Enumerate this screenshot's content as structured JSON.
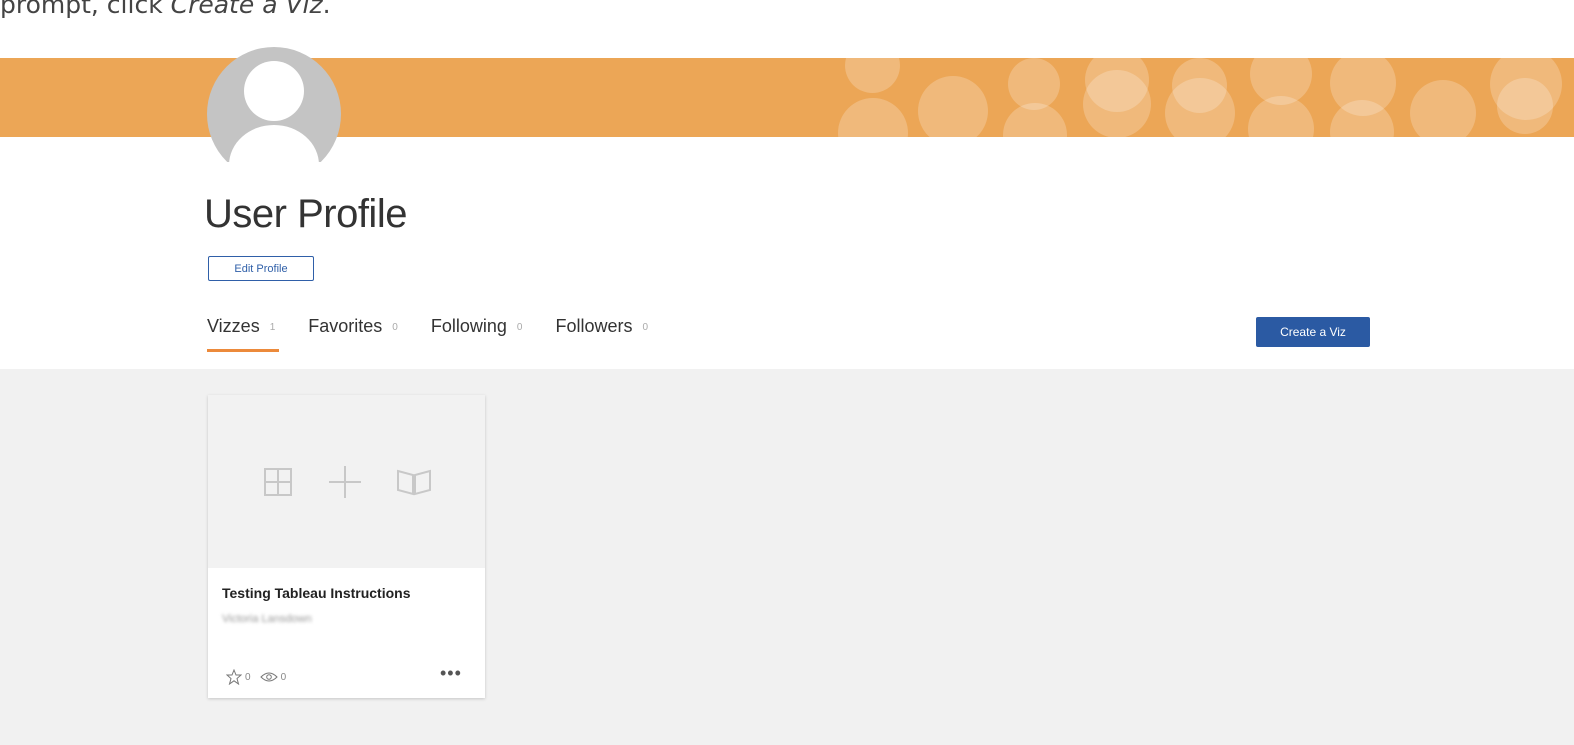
{
  "instruction": {
    "prefix": "prompt, click ",
    "emphasis": "Create a Viz",
    "suffix": "."
  },
  "profile": {
    "title": "User Profile",
    "edit_label": "Edit Profile"
  },
  "tabs": [
    {
      "label": "Vizzes",
      "count": "1",
      "active": true
    },
    {
      "label": "Favorites",
      "count": "0",
      "active": false
    },
    {
      "label": "Following",
      "count": "0",
      "active": false
    },
    {
      "label": "Followers",
      "count": "0",
      "active": false
    }
  ],
  "create_label": "Create a Viz",
  "card": {
    "title": "Testing Tableau Instructions",
    "author": "Victoria Lansdown",
    "favorites": "0",
    "views": "0",
    "more": "•••"
  },
  "colors": {
    "banner": "#eca656",
    "accent": "#ec8a3b",
    "primary": "#2b5aa3"
  },
  "icons": [
    "grid-icon",
    "plus-icon",
    "book-icon",
    "star-icon",
    "eye-icon",
    "more-icon"
  ]
}
